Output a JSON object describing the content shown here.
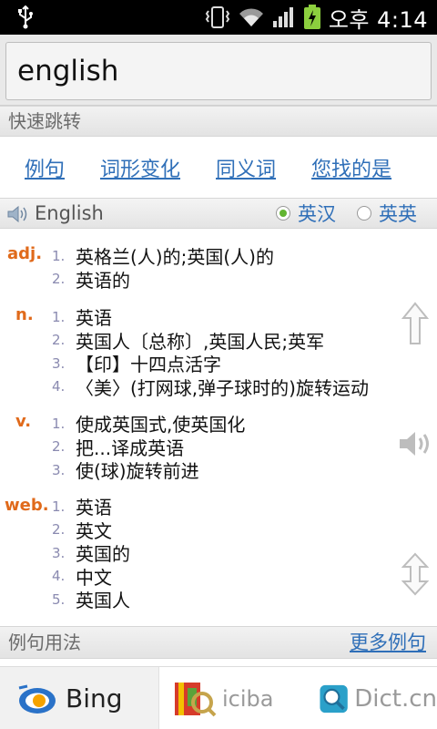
{
  "status_bar": {
    "time": "오후 4:14"
  },
  "search": {
    "value": "english"
  },
  "quick_jump": {
    "title": "快速跳转",
    "links": [
      "例句",
      "词形变化",
      "同义词",
      "您找的是"
    ]
  },
  "word_header": {
    "word": "English",
    "options": [
      {
        "label": "英汉",
        "selected": true
      },
      {
        "label": "英英",
        "selected": false
      }
    ]
  },
  "definitions": [
    {
      "pos": "adj.",
      "items": [
        "英格兰(人)的;英国(人)的",
        "英语的"
      ]
    },
    {
      "pos": "n.",
      "items": [
        "英语",
        "英国人〔总称〕,英国人民;英军",
        "【印】十四点活字",
        "〈美〉(打网球,弹子球时的)旋转运动"
      ]
    },
    {
      "pos": "v.",
      "items": [
        "使成英国式,使英国化",
        "把...译成英语",
        "使(球)旋转前进"
      ]
    },
    {
      "pos": "web.",
      "items": [
        "英语",
        "英文",
        "英国的",
        "中文",
        "英国人"
      ]
    }
  ],
  "usage": {
    "title": "例句用法",
    "more": "更多例句"
  },
  "tabs": [
    {
      "label": "Bing",
      "active": true,
      "icon": "bing-logo-icon"
    },
    {
      "label": "iciba",
      "active": false,
      "icon": "iciba-book-icon"
    },
    {
      "label": "Dict.cn",
      "active": false,
      "icon": "dictcn-magnifier-icon"
    }
  ],
  "colors": {
    "link": "#2f6fb8",
    "pos": "#e06a1b",
    "radio_on": "#62b531"
  }
}
